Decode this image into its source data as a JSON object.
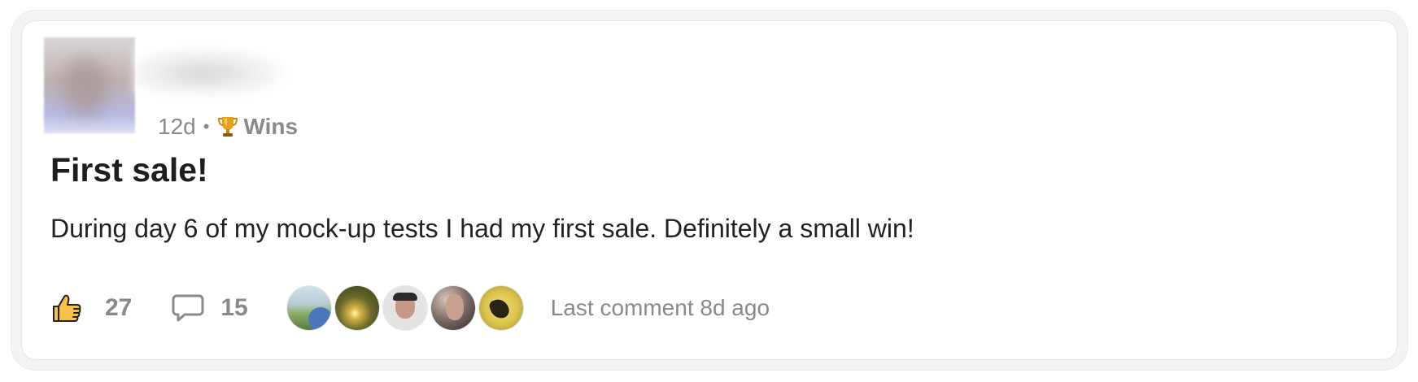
{
  "post": {
    "time_ago": "12d",
    "separator": "•",
    "category_icon": "trophy-icon",
    "category": "Wins",
    "title": "First sale!",
    "body": "During day 6 of my mock-up tests I had my first sale. Definitely a small win!"
  },
  "actions": {
    "like_icon": "thumbs-up-icon",
    "like_count": "27",
    "comment_icon": "comment-bubble-icon",
    "comment_count": "15",
    "last_comment": "Last comment 8d ago"
  },
  "colors": {
    "muted_text": "#8a8a8a",
    "title_text": "#1e1e1e",
    "like_fill": "#f7c14a",
    "card_border": "#e4e4e4"
  }
}
